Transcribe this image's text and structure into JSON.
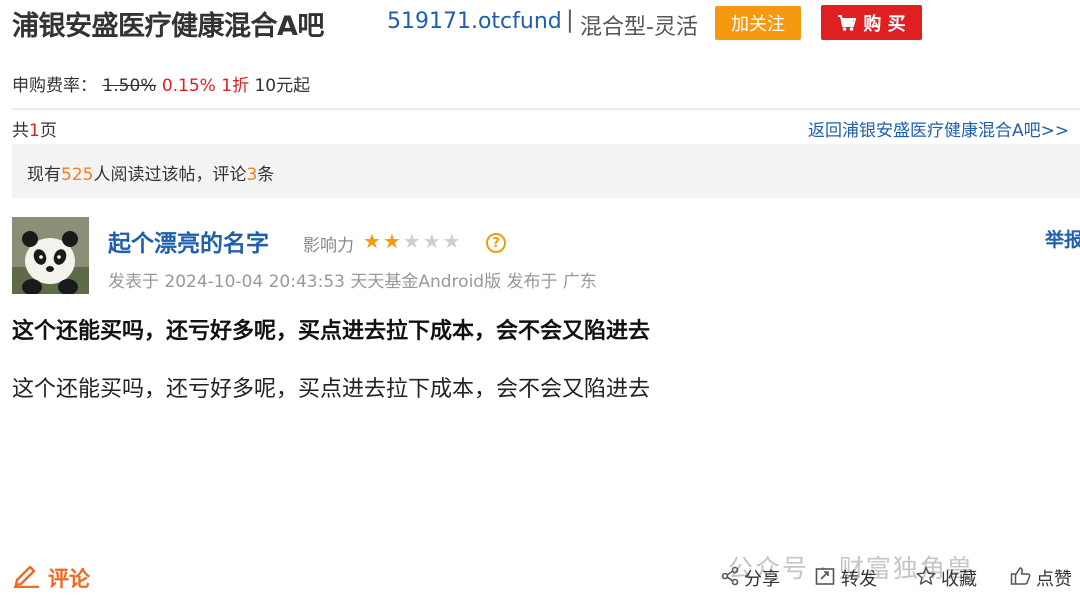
{
  "header": {
    "fund_name": "浦银安盛医疗健康混合A吧",
    "fund_code": "519171.otcfund",
    "separator": "|",
    "fund_type": "混合型-灵活",
    "follow_label": "加关注",
    "buy_label": "购 买"
  },
  "fee": {
    "label": "申购费率：",
    "original": "1.50%",
    "current": "0.15%",
    "discount": "1折",
    "minimum": "10元起"
  },
  "pagination": {
    "prefix": "共",
    "count": "1",
    "suffix": "页",
    "back_link": "返回浦银安盛医疗健康混合A吧>>"
  },
  "read_stats": {
    "p1": "现有",
    "readers": "525",
    "p2": "人阅读过该帖，评论",
    "comments": "3",
    "p3": "条"
  },
  "post": {
    "author": "起个漂亮的名字",
    "influence_label": "影响力",
    "stars_filled": 2,
    "stars_total": 5,
    "report_label": "举报",
    "meta": "发表于 2024-10-04 20:43:53 天天基金Android版 发布于 广东",
    "title": "这个还能买吗，还亏好多呢，买点进去拉下成本，会不会又陷进去",
    "body": "这个还能买吗，还亏好多呢，买点进去拉下成本，会不会又陷进去"
  },
  "footer": {
    "comment_label": "评论",
    "share_label": "分享",
    "forward_label": "转发",
    "collect_label": "收藏",
    "like_label": "点赞",
    "watermark": "公众号 · 财富独角兽"
  },
  "colors": {
    "link_blue": "#1f5fae",
    "accent_orange": "#f59a10",
    "buy_red": "#e02020"
  }
}
